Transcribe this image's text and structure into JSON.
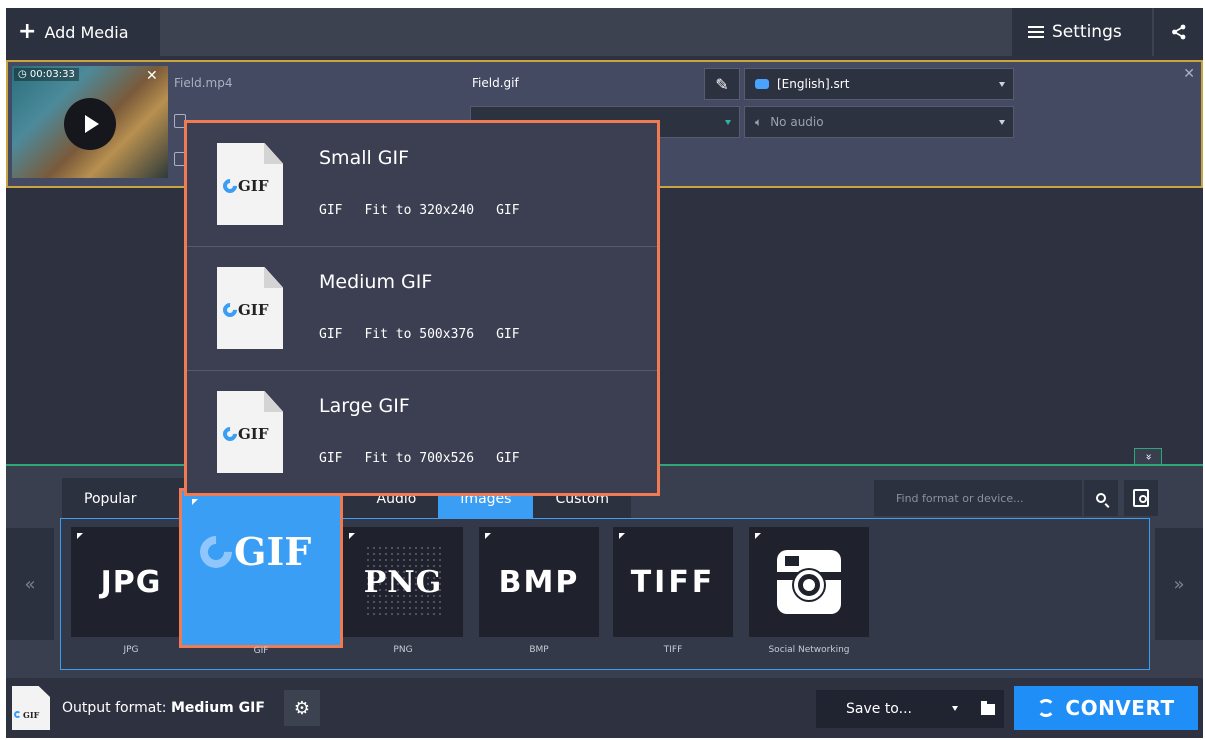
{
  "toolbar": {
    "add_media_label": "Add Media",
    "settings_label": "Settings",
    "share_icon": "share-icon"
  },
  "file": {
    "duration": "00:03:33",
    "source_name": "Field.mp4",
    "output_name": "Field.gif",
    "subtitle": "[English].srt",
    "audio": "No audio"
  },
  "presets": [
    {
      "name": "Small GIF",
      "format": "GIF",
      "size": "Fit to 320x240",
      "codec": "GIF"
    },
    {
      "name": "Medium GIF",
      "format": "GIF",
      "size": "Fit to 500x376",
      "codec": "GIF"
    },
    {
      "name": "Large GIF",
      "format": "GIF",
      "size": "Fit to 700x526",
      "codec": "GIF"
    }
  ],
  "tabs": {
    "popular": "Popular",
    "audio": "Audio",
    "images": "Images",
    "custom": "Custom"
  },
  "search": {
    "placeholder": "Find format or device..."
  },
  "formats": {
    "jpg": {
      "logo": "JPG",
      "label": "JPG"
    },
    "gif": {
      "logo": "GIF",
      "label": "GIF"
    },
    "png": {
      "logo": "PNG",
      "label": "PNG"
    },
    "bmp": {
      "logo": "BMP",
      "label": "BMP"
    },
    "tiff": {
      "logo": "TIFF",
      "label": "TIFF"
    },
    "social": {
      "label": "Social Networking"
    }
  },
  "nav": {
    "prev": "«",
    "next": "»",
    "collapse": "»"
  },
  "footer": {
    "output_prefix": "Output format:",
    "output_value": "Medium GIF",
    "doc_label": "GIF",
    "save_to": "Save to...",
    "convert": "CONVERT"
  },
  "colors": {
    "accent": "#3a9ef5",
    "highlight": "#ee7b51",
    "selected_row": "#c9a640",
    "convert": "#1f8ef6"
  }
}
